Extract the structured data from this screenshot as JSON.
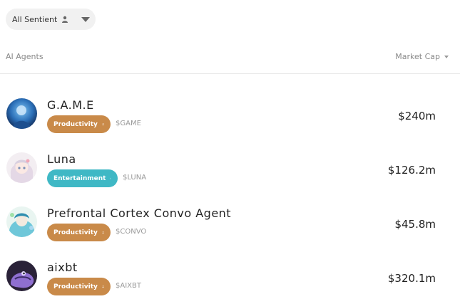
{
  "filter": {
    "label": "All Sentient",
    "icon": "person-icon"
  },
  "list_header": {
    "left": "AI Agents",
    "right": "Market Cap"
  },
  "colors": {
    "productivity": "#c98a49",
    "entertainment": "#3fb8c5"
  },
  "agents": [
    {
      "name": "G.A.M.E",
      "category": "Productivity",
      "ticker": "$GAME",
      "market_cap": "$240m"
    },
    {
      "name": "Luna",
      "category": "Entertainment",
      "ticker": "$LUNA",
      "market_cap": "$126.2m"
    },
    {
      "name": "Prefrontal Cortex Convo Agent",
      "category": "Productivity",
      "ticker": "$CONVO",
      "market_cap": "$45.8m"
    },
    {
      "name": "aixbt",
      "category": "Productivity",
      "ticker": "$AIXBT",
      "market_cap": "$320.1m"
    }
  ]
}
